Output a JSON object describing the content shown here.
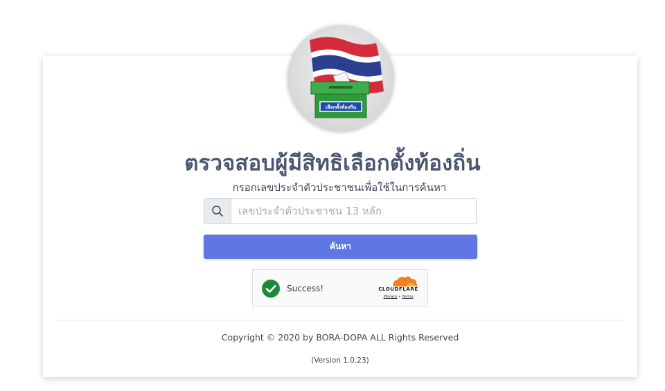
{
  "header": {
    "logo_label": "เลือกตั้งท้องถิ่น",
    "title": "ตรวจสอบผู้มีสิทธิเลือกตั้งท้องถิ่น",
    "subtitle": "กรอกเลขประจำตัวประชาชนเพื่อใช้ในการค้นหา"
  },
  "search": {
    "icon": "search-icon",
    "placeholder": "เลขประจำตัวประชาชน 13 หลัก",
    "value": "",
    "button_label": "ค้นหา"
  },
  "captcha": {
    "status": "Success!",
    "provider": "CLOUDFLARE",
    "privacy_label": "Privacy",
    "separator": "•",
    "terms_label": "Terms"
  },
  "footer": {
    "copyright": "Copyright © 2020 by BORA-DOPA ALL Rights Reserved",
    "version": "(Version 1.0.23)"
  },
  "colors": {
    "accent": "#5f77e3",
    "title": "#4b5570",
    "success": "#1d8a3a",
    "cloudflare": "#f38020"
  }
}
